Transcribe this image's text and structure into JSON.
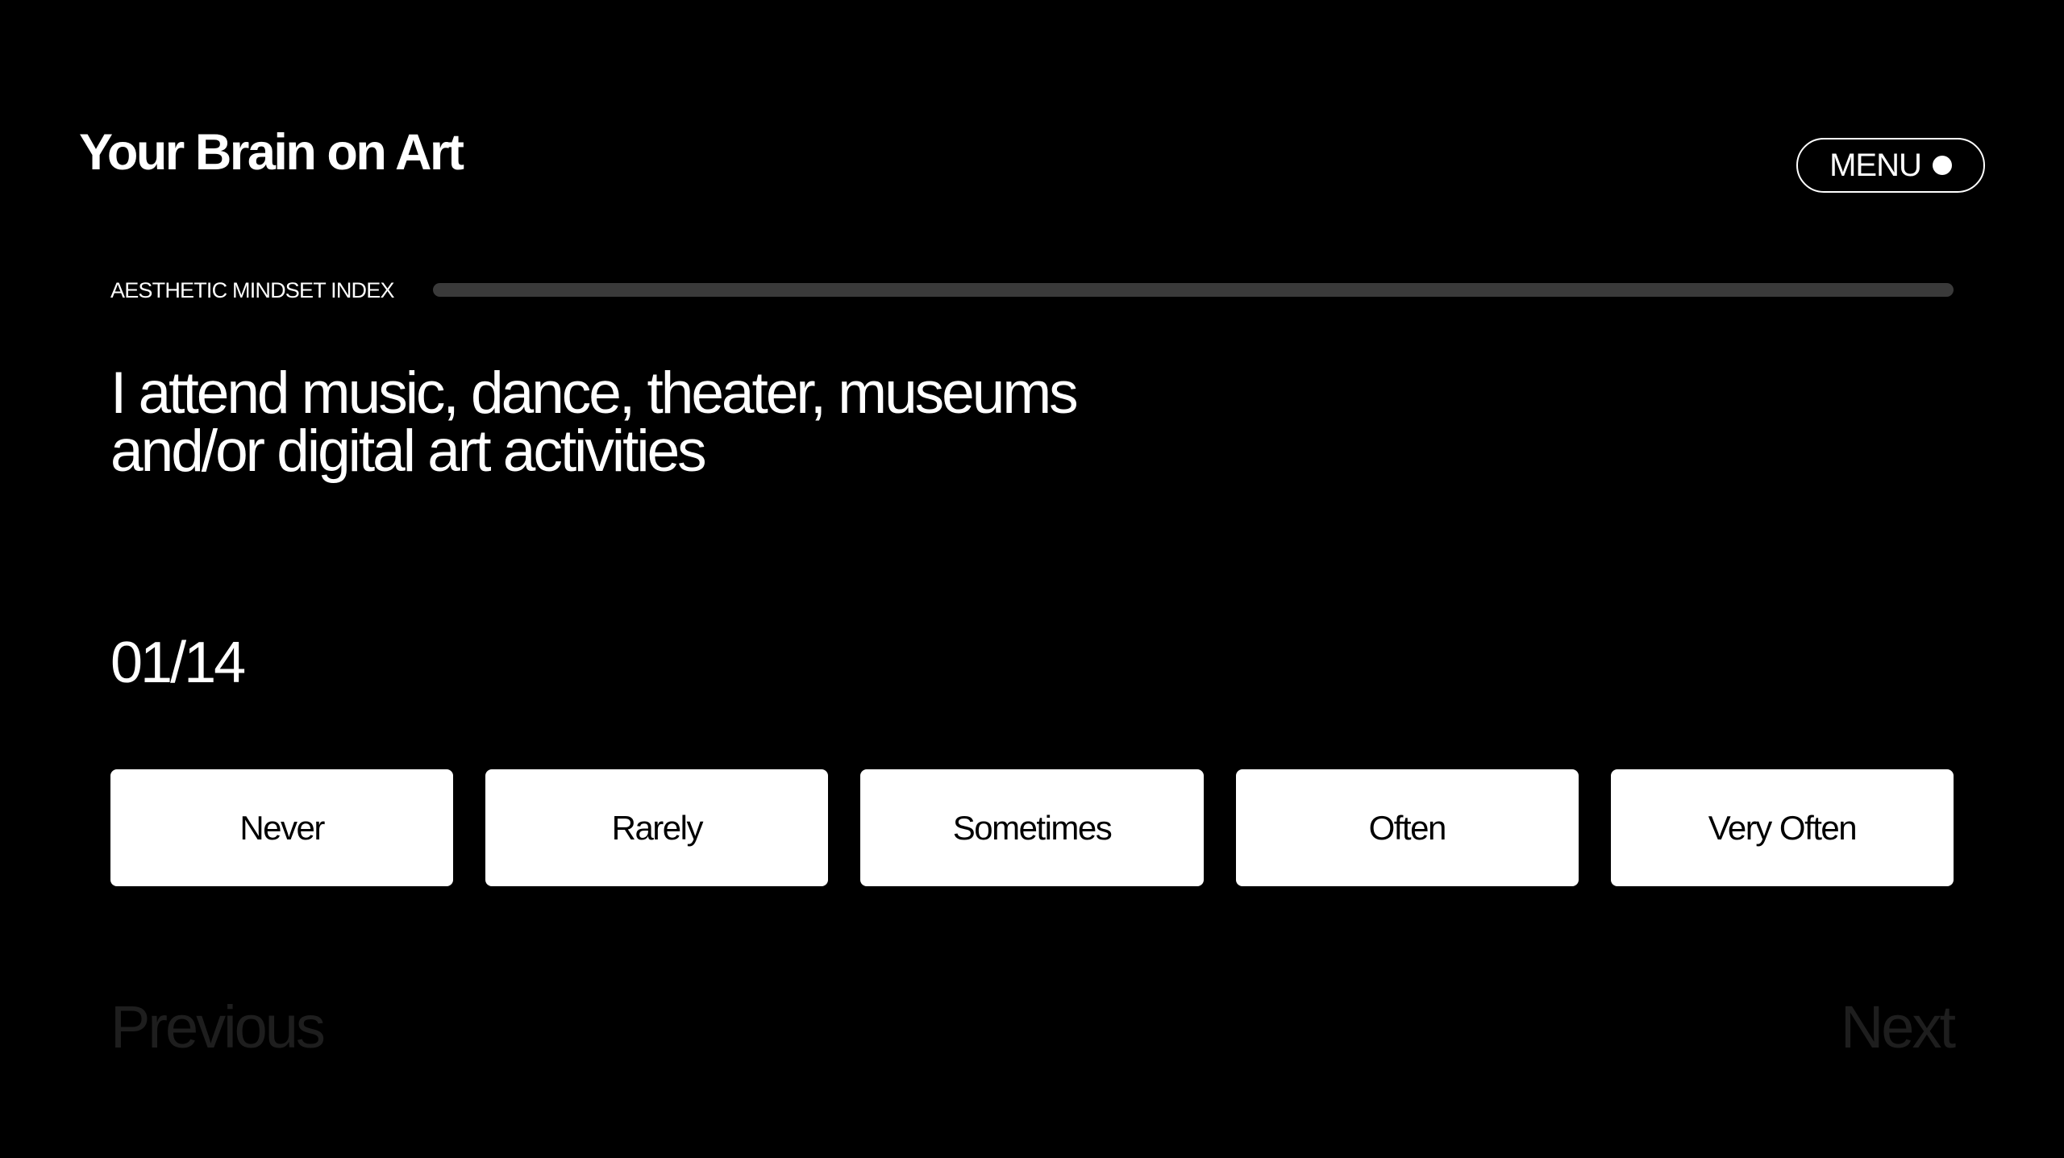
{
  "header": {
    "title": "Your Brain on Art",
    "menu_label": "MENU"
  },
  "survey": {
    "section_label": "AESTHETIC MINDSET INDEX",
    "progress": 0,
    "question_line1": "I attend music, dance, theater, museums",
    "question_line2": "and/or digital art activities",
    "counter": "01/14",
    "options": [
      "Never",
      "Rarely",
      "Sometimes",
      "Often",
      "Very Often"
    ]
  },
  "navigation": {
    "previous_label": "Previous",
    "next_label": "Next"
  },
  "colors": {
    "background": "#000000",
    "foreground": "#ffffff",
    "option_background": "#ffffff",
    "option_text": "#000000",
    "progress_track": "#3a3a3a",
    "nav_disabled": "#1e1e1e"
  }
}
